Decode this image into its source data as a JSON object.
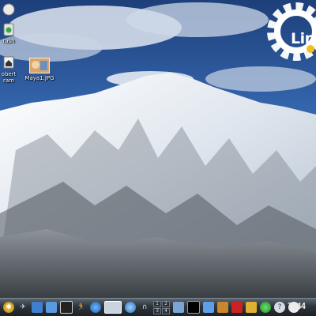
{
  "desktop": {
    "icons": [
      {
        "name": "trash-icon",
        "label": "rash"
      },
      {
        "name": "home-icon",
        "label": "obert\nram"
      },
      {
        "name": "image-file-icon",
        "label": "Maya1.JPG"
      }
    ],
    "logo": {
      "text": "Lin"
    }
  },
  "taskbar": {
    "launchers": [
      "k-menu-icon",
      "airplane-icon",
      "desktop-icon",
      "konqueror-icon",
      "monitor-icon",
      "person-run-icon",
      "globe-icon",
      "computer-icon",
      "network-icon"
    ],
    "pager": [
      "1",
      "2",
      "3",
      "4"
    ],
    "tray": [
      "window-icon",
      "terminal-icon",
      "folder-icon",
      "package-icon",
      "book-icon",
      "email-icon",
      "network-status-icon",
      "help-icon",
      "chat-icon"
    ],
    "clock": "7:44"
  },
  "colors": {
    "sky": "#2b5aa0",
    "taskbar": "#2d343b",
    "snow": "#eef2f6"
  }
}
